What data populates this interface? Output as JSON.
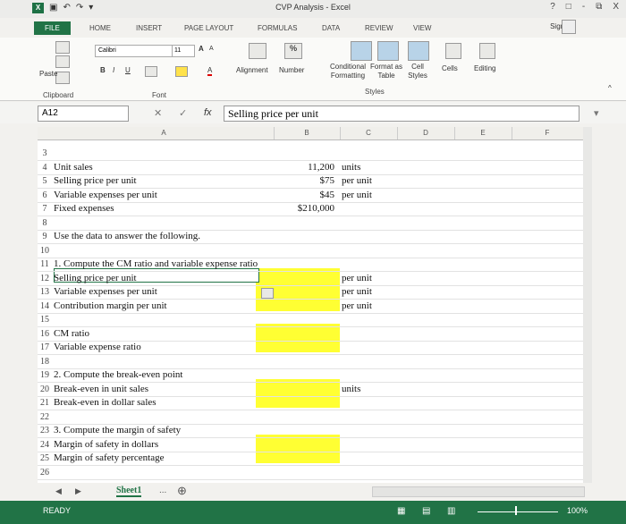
{
  "window": {
    "title": "CVP Analysis - Excel"
  },
  "titlebar": {
    "help": "?",
    "minimize": "-",
    "restore": "□",
    "close": "X"
  },
  "tabs": [
    "FILE",
    "HOME",
    "INSERT",
    "PAGE LAYOUT",
    "FORMULAS",
    "DATA",
    "REVIEW",
    "VIEW"
  ],
  "account": {
    "signin": "Sign In"
  },
  "ribbon": {
    "paste": "Paste",
    "font_name": "Calibri",
    "font_size": "11",
    "grow": "A",
    "shrink": "A",
    "bold": "B",
    "italic": "I",
    "underline": "U",
    "alignment": "Alignment",
    "percent": "%",
    "number": "Number",
    "cond_format": "Conditional Formatting",
    "format_table": "Format as Table",
    "cell_styles": "Cell Styles",
    "cells": "Cells",
    "editing": "Editing",
    "group_clipboard": "Clipboard",
    "group_font": "Font",
    "group_styles": "Styles"
  },
  "formula_bar": {
    "name_box": "A12",
    "fx": "fx",
    "value": "Selling price per unit"
  },
  "columns": [
    "A",
    "B",
    "C",
    "D",
    "E",
    "F"
  ],
  "rows": [
    {
      "n": "3",
      "a": "",
      "b": "",
      "c": ""
    },
    {
      "n": "4",
      "a": "Unit sales",
      "b": "11,200",
      "c": "units"
    },
    {
      "n": "5",
      "a": "Selling price per unit",
      "b": "$75",
      "c": "per unit"
    },
    {
      "n": "6",
      "a": "Variable expenses per unit",
      "b": "$45",
      "c": "per unit"
    },
    {
      "n": "7",
      "a": "Fixed expenses",
      "b": "$210,000",
      "c": ""
    },
    {
      "n": "8",
      "a": "",
      "b": "",
      "c": ""
    },
    {
      "n": "9",
      "a": "Use the data to answer the following.",
      "b": "",
      "c": ""
    },
    {
      "n": "10",
      "a": "",
      "b": "",
      "c": ""
    },
    {
      "n": "11",
      "a": "1. Compute the CM ratio and variable expense ratio",
      "b": "",
      "c": ""
    },
    {
      "n": "12",
      "a": "Selling price per unit",
      "b": "",
      "c": "per unit"
    },
    {
      "n": "13",
      "a": "Variable expenses per unit",
      "b": "",
      "c": "per unit"
    },
    {
      "n": "14",
      "a": "Contribution margin per unit",
      "b": "",
      "c": "per unit"
    },
    {
      "n": "15",
      "a": "",
      "b": "",
      "c": ""
    },
    {
      "n": "16",
      "a": "CM ratio",
      "b": "",
      "c": ""
    },
    {
      "n": "17",
      "a": "Variable expense ratio",
      "b": "",
      "c": ""
    },
    {
      "n": "18",
      "a": "",
      "b": "",
      "c": ""
    },
    {
      "n": "19",
      "a": "2. Compute the break-even point",
      "b": "",
      "c": ""
    },
    {
      "n": "20",
      "a": "Break-even in unit sales",
      "b": "",
      "c": "units"
    },
    {
      "n": "21",
      "a": "Break-even in dollar sales",
      "b": "",
      "c": ""
    },
    {
      "n": "22",
      "a": "",
      "b": "",
      "c": ""
    },
    {
      "n": "23",
      "a": "3. Compute the margin of safety",
      "b": "",
      "c": ""
    },
    {
      "n": "24",
      "a": "Margin of safety in dollars",
      "b": "",
      "c": ""
    },
    {
      "n": "25",
      "a": "Margin of safety percentage",
      "b": "",
      "c": ""
    },
    {
      "n": "26",
      "a": "",
      "b": "",
      "c": ""
    }
  ],
  "sheet_tabs": {
    "active": "Sheet1",
    "more": "..."
  },
  "status": {
    "ready": "READY",
    "zoom": "100%"
  },
  "colors": {
    "excel_green": "#217346",
    "highlight": "#ffff33"
  }
}
